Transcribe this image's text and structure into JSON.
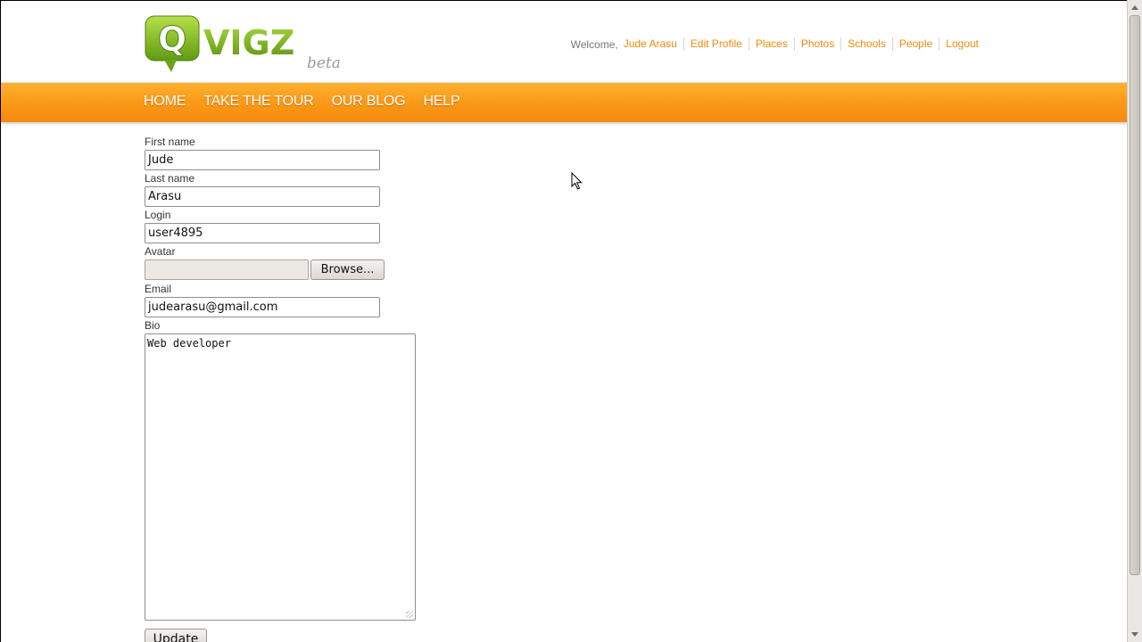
{
  "header": {
    "logo": {
      "wordmark": "VIGZ",
      "badge_letter": "Q",
      "tag": "beta"
    },
    "welcome_text": "Welcome,",
    "links": [
      {
        "label": "Jude Arasu"
      },
      {
        "label": "Edit Profile"
      },
      {
        "label": "Places"
      },
      {
        "label": "Photos"
      },
      {
        "label": "Schools"
      },
      {
        "label": "People"
      },
      {
        "label": "Logout"
      }
    ]
  },
  "nav": {
    "items": [
      {
        "label": "HOME"
      },
      {
        "label": "TAKE THE TOUR"
      },
      {
        "label": "OUR BLOG"
      },
      {
        "label": "HELP"
      }
    ]
  },
  "form": {
    "first_name": {
      "label": "First name",
      "value": "Jude"
    },
    "last_name": {
      "label": "Last name",
      "value": "Arasu"
    },
    "login": {
      "label": "Login",
      "value": "user4895"
    },
    "avatar": {
      "label": "Avatar",
      "browse_label": "Browse..."
    },
    "email": {
      "label": "Email",
      "value": "judearasu@gmail.com"
    },
    "bio": {
      "label": "Bio",
      "value": "Web developer"
    },
    "submit_label": "Update"
  },
  "colors": {
    "accent": "#f08a0c",
    "nav_bar": "#fb9b19",
    "logo_green": "#7ab51d"
  },
  "icons": [
    "logo-speech-bubble-icon",
    "mouse-cursor-icon",
    "scroll-up-arrow-icon",
    "scroll-down-arrow-icon"
  ]
}
